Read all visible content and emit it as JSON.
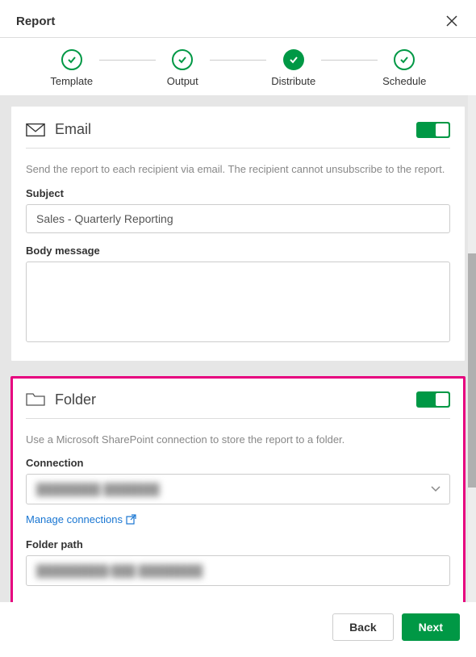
{
  "header": {
    "title": "Report"
  },
  "stepper": {
    "steps": [
      {
        "label": "Template",
        "state": "done-outline"
      },
      {
        "label": "Output",
        "state": "done-outline"
      },
      {
        "label": "Distribute",
        "state": "done-filled"
      },
      {
        "label": "Schedule",
        "state": "done-outline"
      }
    ]
  },
  "email_section": {
    "title": "Email",
    "description": "Send the report to each recipient via email. The recipient cannot unsubscribe to the report.",
    "subject_label": "Subject",
    "subject_value": "Sales - Quarterly Reporting",
    "body_label": "Body message",
    "body_value": "",
    "toggle_on": true
  },
  "folder_section": {
    "title": "Folder",
    "description": "Use a Microsoft SharePoint connection to store the report to a folder.",
    "connection_label": "Connection",
    "connection_value": "████████ ███████",
    "manage_link": "Manage connections",
    "path_label": "Folder path",
    "path_value": "█████████/███ ████████",
    "toggle_on": true
  },
  "footer": {
    "back": "Back",
    "next": "Next"
  }
}
